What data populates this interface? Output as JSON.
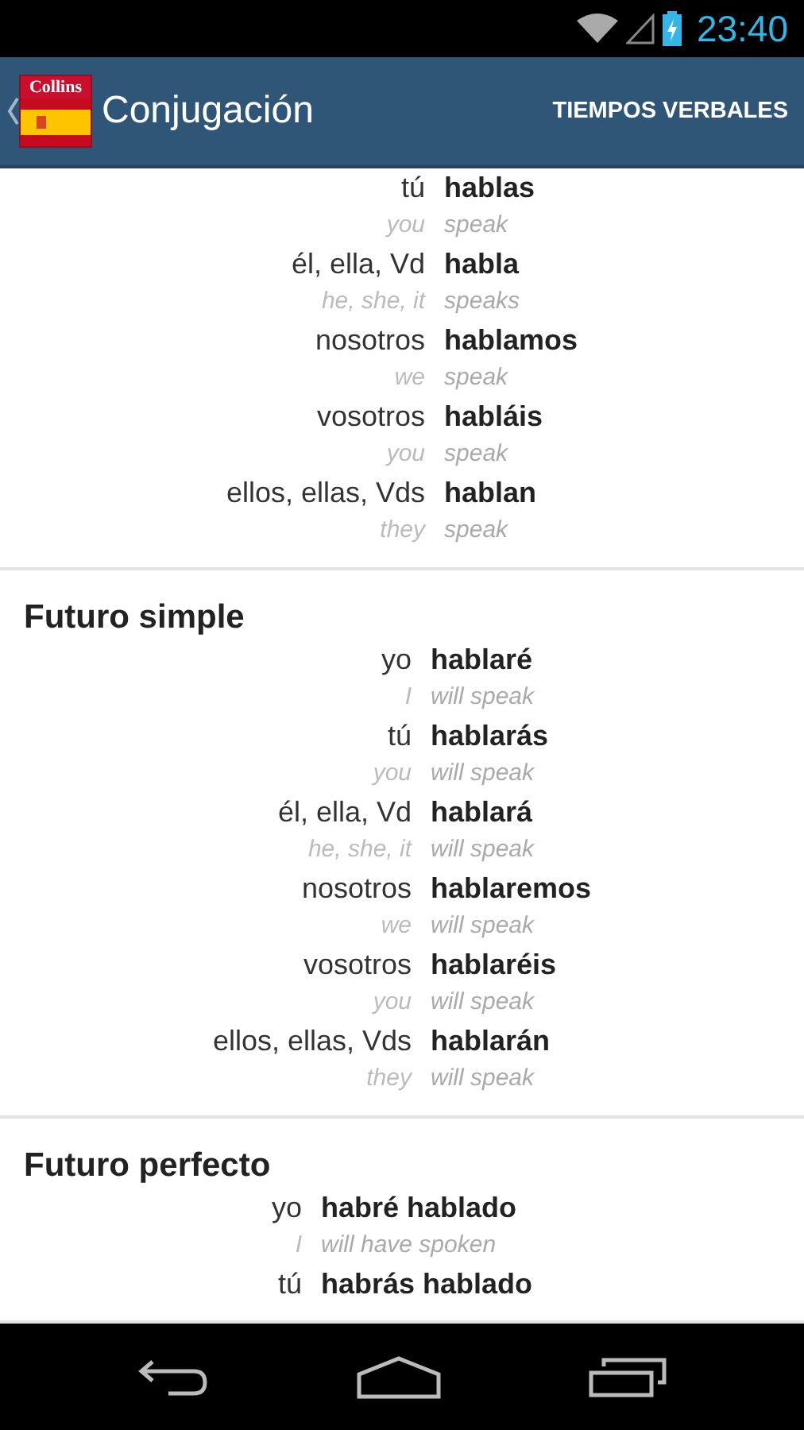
{
  "status_bar": {
    "time": "23:40"
  },
  "app_bar": {
    "logo_text": "Collins",
    "title": "Conjugación",
    "action": "TIEMPOS VERBALES"
  },
  "sections": [
    {
      "rows": [
        {
          "pronoun": "tú",
          "verb": "hablas",
          "pronoun_en": "you",
          "verb_en": "speak"
        },
        {
          "pronoun": "él, ella, Vd",
          "verb": "habla",
          "pronoun_en": "he, she, it",
          "verb_en": "speaks"
        },
        {
          "pronoun": "nosotros",
          "verb": "hablamos",
          "pronoun_en": "we",
          "verb_en": "speak"
        },
        {
          "pronoun": "vosotros",
          "verb": "habláis",
          "pronoun_en": "you",
          "verb_en": "speak"
        },
        {
          "pronoun": "ellos, ellas, Vds",
          "verb": "hablan",
          "pronoun_en": "they",
          "verb_en": "speak"
        }
      ]
    },
    {
      "title": "Futuro simple",
      "rows": [
        {
          "pronoun": "yo",
          "verb": "hablaré",
          "pronoun_en": "I",
          "verb_en": "will speak"
        },
        {
          "pronoun": "tú",
          "verb": "hablarás",
          "pronoun_en": "you",
          "verb_en": "will speak"
        },
        {
          "pronoun": "él, ella, Vd",
          "verb": "hablará",
          "pronoun_en": "he, she, it",
          "verb_en": "will speak"
        },
        {
          "pronoun": "nosotros",
          "verb": "hablaremos",
          "pronoun_en": "we",
          "verb_en": "will speak"
        },
        {
          "pronoun": "vosotros",
          "verb": "hablaréis",
          "pronoun_en": "you",
          "verb_en": "will speak"
        },
        {
          "pronoun": "ellos, ellas, Vds",
          "verb": "hablarán",
          "pronoun_en": "they",
          "verb_en": "will speak"
        }
      ]
    },
    {
      "title": "Futuro perfecto",
      "rows": [
        {
          "pronoun": "yo",
          "verb": "habré hablado",
          "pronoun_en": "I",
          "verb_en": "will have spoken"
        },
        {
          "pronoun": "tú",
          "verb": "habrás hablado"
        }
      ]
    }
  ]
}
